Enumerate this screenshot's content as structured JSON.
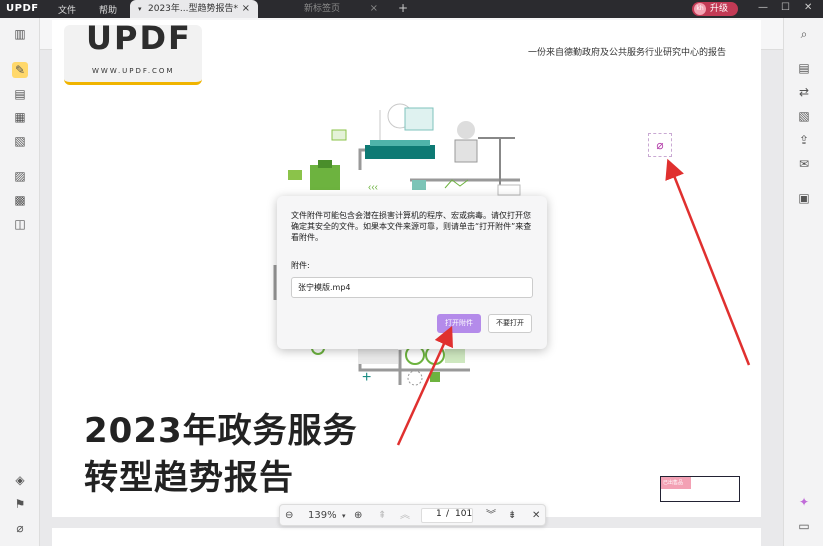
{
  "app": {
    "logo": "UPDF"
  },
  "menu": {
    "file": "文件",
    "help": "帮助"
  },
  "tabs": [
    {
      "label": "2023年...型趋势报告*",
      "close": "×"
    },
    {
      "label": "新标签页",
      "close": "×"
    }
  ],
  "add_tab": "+",
  "upgrade": {
    "label": "升级",
    "avatar": "kh"
  },
  "window": {
    "minimize": "—",
    "maximize": "☐",
    "close": "✕"
  },
  "colors": {
    "accent": "#b48bea",
    "upgrade": "#c23a55",
    "annotation_arrow": "#e0302f"
  },
  "toolbar": {
    "icons": [
      "comment-icon",
      "highlight-icon",
      "strikethrough-icon",
      "underline-icon",
      "squiggly-icon",
      "text-icon",
      "textbox-icon",
      "text-callout-icon",
      "pencil-icon",
      "eraser-icon",
      "shape-icon",
      "sticker-icon",
      "attachment-icon",
      "stamp-icon",
      "signature-icon"
    ]
  },
  "page": {
    "logo_big": "UPDF",
    "logo_url": "WWW.UPDF.COM",
    "subtitle": "一份来自德勤政府及公共服务行业研究中心的报告",
    "heading_line1": "2023年政务服务",
    "heading_line2": "转型趋势报告",
    "stamp_flag": "已出售品"
  },
  "dialog": {
    "message": "文件附件可能包含会潜在损害计算机的程序、宏或病毒。请仅打开您确定其安全的文件。如果本文件来源可靠，则请单击“打开附件”来查看附件。",
    "attachment_label": "附件:",
    "attachment_file": "张宁模版.mp4",
    "open_button": "打开附件",
    "dont_open_button": "不要打开"
  },
  "pager": {
    "zoom": "139%",
    "current_page": "1",
    "separator": "/",
    "total_pages": "101"
  }
}
